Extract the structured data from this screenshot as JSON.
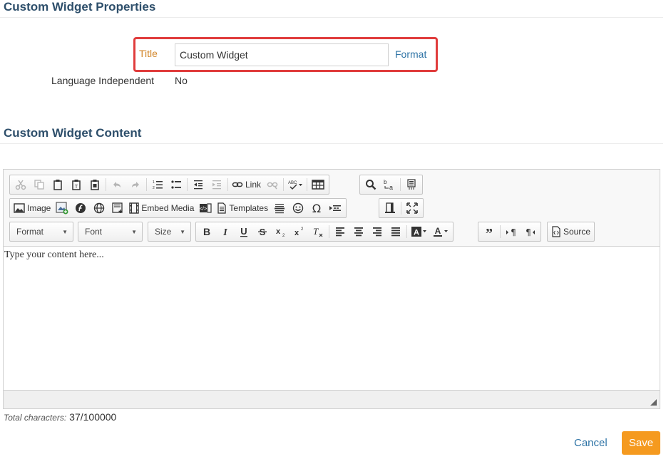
{
  "properties": {
    "heading": "Custom Widget Properties",
    "title_label": "Title",
    "title_value": "Custom Widget",
    "format_link": "Format",
    "language_label": "Language Independent",
    "language_value": "No"
  },
  "content": {
    "heading": "Custom Widget Content"
  },
  "editor": {
    "toolbar": {
      "link_label": "Link",
      "image_label": "Image",
      "embed_media_label": "Embed Media",
      "templates_label": "Templates",
      "source_label": "Source",
      "format_combo": "Format",
      "font_combo": "Font",
      "size_combo": "Size",
      "spellcheck_label": "ABC"
    },
    "placeholder": "Type your content here...",
    "status": {
      "label": "Total characters:",
      "value": "37/100000"
    }
  },
  "actions": {
    "cancel_label": "Cancel",
    "save_label": "Save"
  },
  "colors": {
    "highlight": "#e03c3c",
    "accent_orange": "#f59a1f",
    "heading_blue": "#2e4f6b",
    "link_blue": "#2f74a6",
    "label_orange": "#d2862a"
  }
}
